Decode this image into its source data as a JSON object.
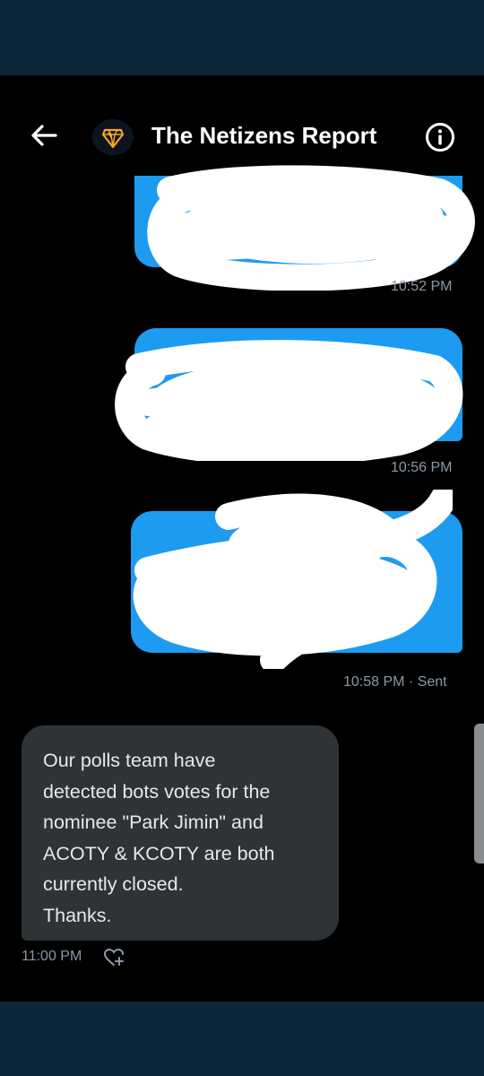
{
  "header": {
    "title": "The Netizens Report",
    "back_icon": "arrow-left-icon",
    "info_icon": "info-icon",
    "avatar_colors": [
      "#f5a623",
      "#0d1420"
    ]
  },
  "messages": [
    {
      "direction": "outgoing",
      "text_redacted": true,
      "timestamp": "10:52 PM"
    },
    {
      "direction": "outgoing",
      "text_redacted": true,
      "timestamp": "10:56 PM"
    },
    {
      "direction": "outgoing",
      "text_redacted": true,
      "timestamp": "10:58 PM · Sent"
    },
    {
      "direction": "incoming",
      "text": "Our polls team have\ndetected bots votes for the\nnominee \"Park Jimin\" and\nACOTY & KCOTY are both\ncurrently closed.\nThanks.",
      "timestamp": "11:00 PM",
      "reaction_icon": "add-reaction-heart-icon"
    }
  ],
  "colors": {
    "outgoing_bubble": "#1d9bf0",
    "incoming_bubble": "#2f3336",
    "background": "#000000",
    "frame": "#0b2638",
    "timestamp": "#8b98a5"
  }
}
